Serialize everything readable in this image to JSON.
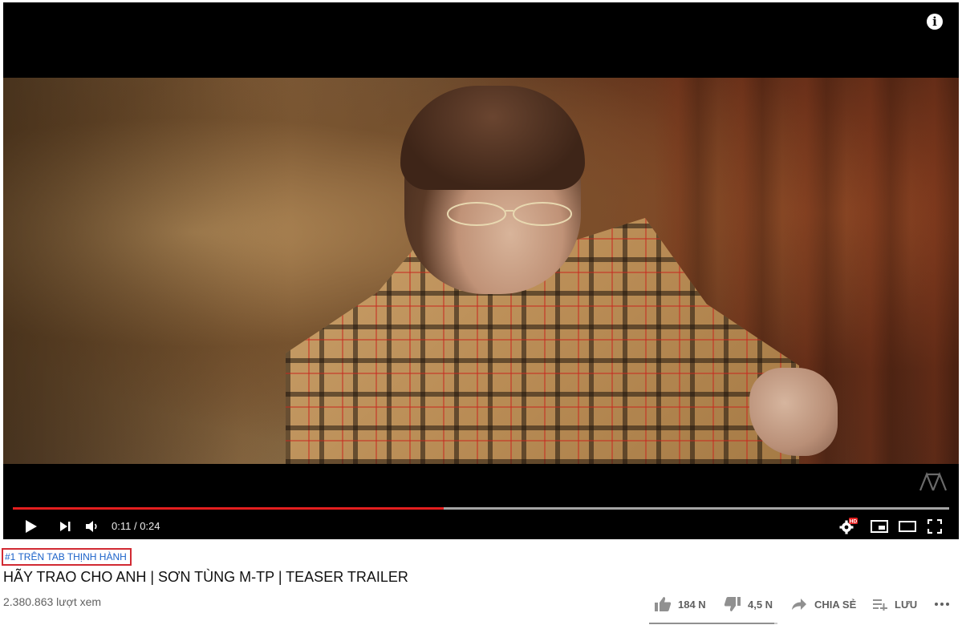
{
  "player": {
    "time_current": "0:11",
    "time_separator": " / ",
    "time_total": "0:24",
    "progress_played": 0.46,
    "progress_loaded": 1.0,
    "quality_badge": "HD",
    "icons": {
      "info": "info-icon",
      "play": "play-icon",
      "next": "next-icon",
      "volume": "volume-icon",
      "settings": "settings-gear-icon",
      "miniplayer": "miniplayer-icon",
      "theater": "theater-mode-icon",
      "fullscreen": "fullscreen-icon",
      "watermark": "channel-watermark-icon"
    }
  },
  "video": {
    "trending_tag": "#1 TRÊN TAB THỊNH HÀNH",
    "title": "HÃY TRAO CHO ANH | SƠN TÙNG M-TP | TEASER TRAILER",
    "views": "2.380.863 lượt xem"
  },
  "actions": {
    "like_count": "184 N",
    "dislike_count": "4,5 N",
    "share_label": "CHIA SẺ",
    "save_label": "LƯU",
    "like_ratio": 0.976
  },
  "colors": {
    "progress_red": "#e41f1f",
    "link_blue": "#1a61c9",
    "tag_border": "#d12a33",
    "hd_badge": "#e41f1f"
  }
}
